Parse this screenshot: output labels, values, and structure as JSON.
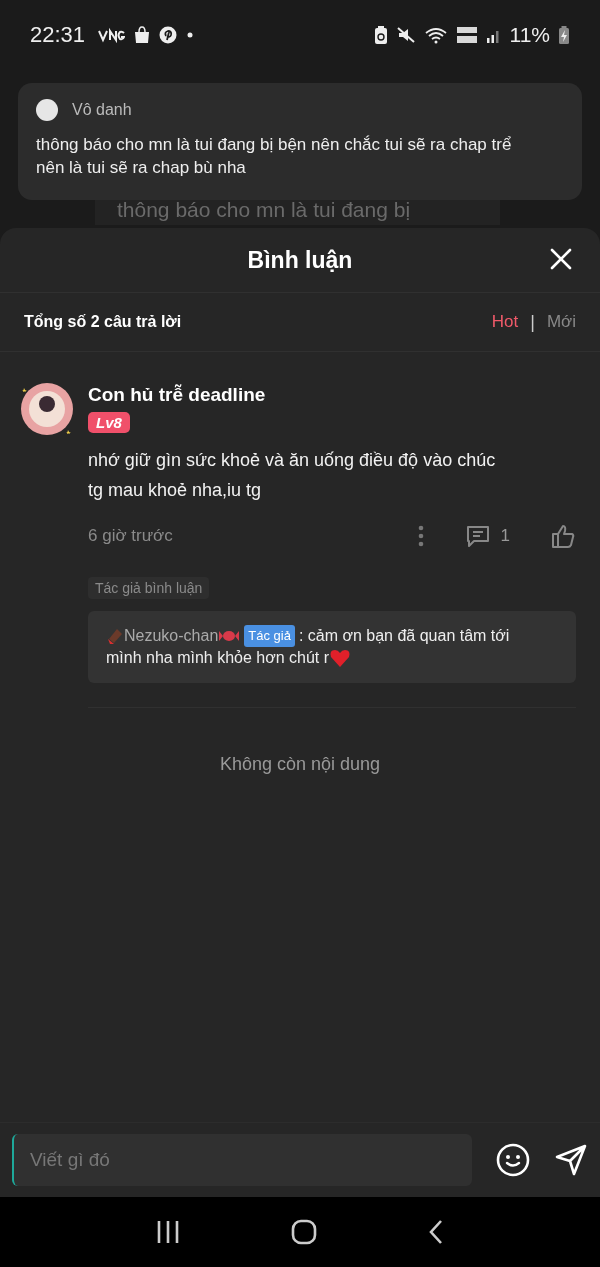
{
  "status_bar": {
    "time": "22:31",
    "battery": "11%"
  },
  "notification": {
    "sender": "Vô danh",
    "message": "thông báo cho mn là tui đang bị bện nên chắc tui sẽ ra chap trể nên là tui sẽ ra chap bù nha"
  },
  "background_message": "thông báo cho mn là tui đang bị",
  "sheet": {
    "title": "Bình luận",
    "total": "Tổng số 2 câu trả lời",
    "sort_tabs": [
      {
        "label": "Hot",
        "selected": true
      },
      {
        "label": "Mới",
        "selected": false
      }
    ],
    "sort_separator": "|",
    "comment": {
      "author": "Con hủ trễ deadline",
      "level": "Lv8",
      "text": "nhớ giữ gìn sức khoẻ và ăn uống điều độ vào chúc tg mau khoẻ nha,iu tg",
      "time": "6 giờ trước",
      "reply_count": "1",
      "author_reply_label": "Tác giả bình luận",
      "reply": {
        "author": "Nezuko-chan",
        "tag": "Tác giả",
        "text_lines": [
          ": cảm ơn bạn đã quan tâm tới",
          "mình nha mình khỏe hơn chút r"
        ]
      }
    },
    "end_text": "Không còn nội dung",
    "input": {
      "placeholder": "Viết gì đó"
    }
  }
}
